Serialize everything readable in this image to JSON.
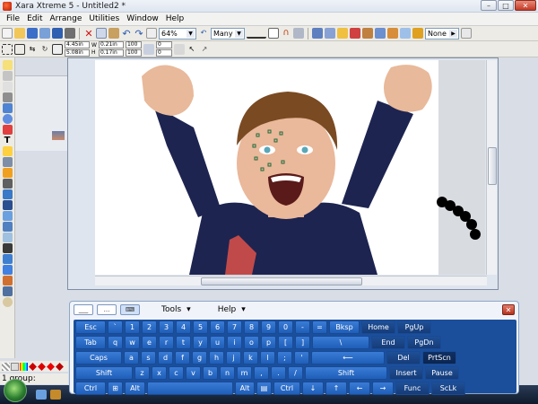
{
  "window": {
    "title": "Xara Xtreme 5 - Untitled2 *"
  },
  "menu": [
    "File",
    "Edit",
    "Arrange",
    "Utilities",
    "Window",
    "Help"
  ],
  "toolbar": {
    "zoom": "64%",
    "selection_mode": "Many",
    "fill_mode": "None",
    "x_field": "4.45in",
    "y_field": "5.08in",
    "w_field": "0.21in",
    "h_field": "0.17in",
    "w_scale": "100",
    "h_scale": "100",
    "rot_field": "0",
    "skew_field": "0"
  },
  "status": {
    "text": "1 group:"
  },
  "keyboard": {
    "menu": [
      "Tools",
      "Help"
    ],
    "rows": [
      [
        "Esc",
        "`",
        "1",
        "2",
        "3",
        "4",
        "5",
        "6",
        "7",
        "8",
        "9",
        "0",
        "-",
        "=",
        "Bksp",
        "Home",
        "PgUp"
      ],
      [
        "Tab",
        "q",
        "w",
        "e",
        "r",
        "t",
        "y",
        "u",
        "i",
        "o",
        "p",
        "[",
        "]",
        "\\",
        "End",
        "PgDn"
      ],
      [
        "Caps",
        "a",
        "s",
        "d",
        "f",
        "g",
        "h",
        "j",
        "k",
        "l",
        ";",
        "'",
        "⟵",
        "Del",
        "PrtScn"
      ],
      [
        "Shift",
        "z",
        "x",
        "c",
        "v",
        "b",
        "n",
        "m",
        ",",
        ".",
        "/",
        "Shift",
        "Insert",
        "Pause"
      ],
      [
        "Ctrl",
        "⊞",
        "Alt",
        "",
        "Alt",
        "▤",
        "Ctrl",
        "↓",
        "↑",
        "←",
        "→",
        "Func",
        "ScLk"
      ]
    ]
  },
  "colors": {
    "keyboard_blue": "#1f5fb9",
    "selection_green": "#2e8b57"
  }
}
